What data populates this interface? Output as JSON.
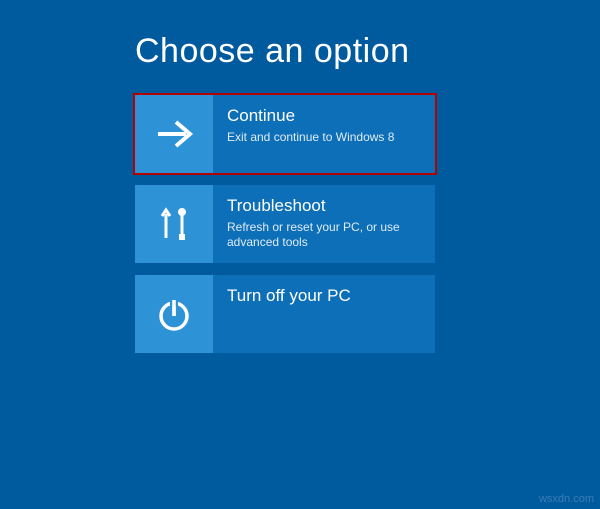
{
  "title": "Choose an option",
  "options": [
    {
      "icon": "arrow-right-icon",
      "title": "Continue",
      "desc": "Exit and continue to Windows 8",
      "highlighted": true
    },
    {
      "icon": "tools-icon",
      "title": "Troubleshoot",
      "desc": "Refresh or reset your PC, or use advanced tools",
      "highlighted": false
    },
    {
      "icon": "power-icon",
      "title": "Turn off your PC",
      "desc": "",
      "highlighted": false
    }
  ],
  "watermark": "wsxdn.com",
  "colors": {
    "background": "#005a9e",
    "tile": "#0c6fb8",
    "iconTile": "#2e93d6",
    "highlightBorder": "#b30000"
  }
}
